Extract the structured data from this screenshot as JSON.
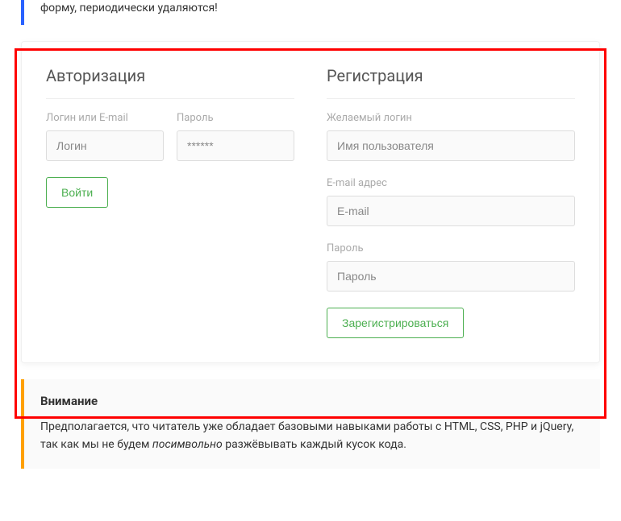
{
  "topNotice": {
    "text": "форму, периодически удаляются!"
  },
  "auth": {
    "title": "Авторизация",
    "loginLabel": "Логин или E-mail",
    "loginPlaceholder": "Логин",
    "passwordLabel": "Пароль",
    "passwordPlaceholder": "******",
    "submitLabel": "Войти"
  },
  "register": {
    "title": "Регистрация",
    "loginLabel": "Желаемый логин",
    "loginPlaceholder": "Имя пользователя",
    "emailLabel": "E-mail адрес",
    "emailPlaceholder": "E-mail",
    "passwordLabel": "Пароль",
    "passwordPlaceholder": "Пароль",
    "submitLabel": "Зарегистрироваться"
  },
  "warning": {
    "title": "Внимание",
    "textBefore": "Предполагается, что читатель уже обладает базовыми навыками работы с HTML, CSS, PHP и jQuery, так как мы не будем ",
    "textItalic": "посимвольно",
    "textAfter": " разжёвывать каждый кусок кода."
  }
}
